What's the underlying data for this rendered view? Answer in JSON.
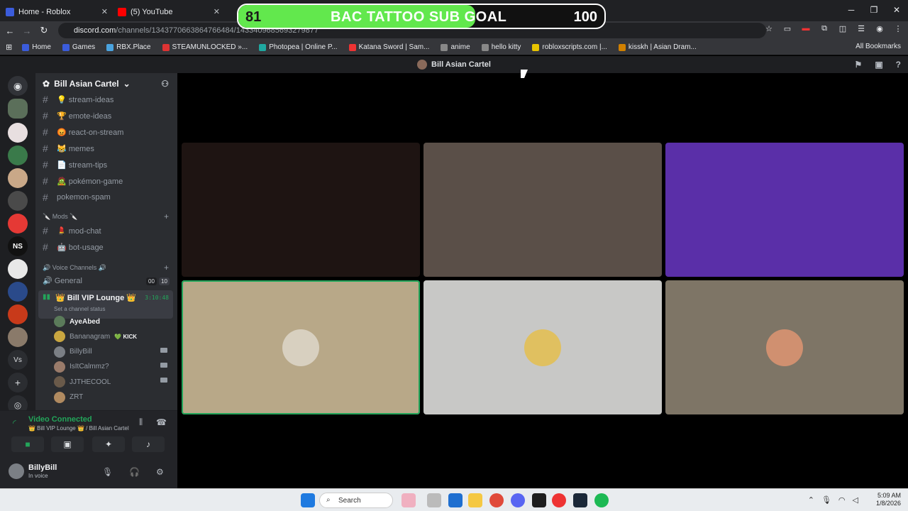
{
  "browser": {
    "tabs": [
      {
        "label": "Home - Roblox",
        "color": "#3b5cdb"
      },
      {
        "label": "(5) YouTube",
        "color": "#ff0000"
      }
    ],
    "url_domain": "discord.com",
    "url_path": "/channels/1343770663864766484/1433409685693279877",
    "bookmarks": [
      {
        "label": "Home",
        "color": "#3b5cdb"
      },
      {
        "label": "Games",
        "color": "#3b5cdb"
      },
      {
        "label": "RBX.Place",
        "color": "#4aa3df"
      },
      {
        "label": "STEAMUNLOCKED »...",
        "color": "#d33"
      },
      {
        "label": "Photopea | Online P...",
        "color": "#1fa8a0"
      },
      {
        "label": "Katana Sword | Sam...",
        "color": "#e33"
      },
      {
        "label": "anime",
        "color": "#888888"
      },
      {
        "label": "hello kitty",
        "color": "#888888"
      },
      {
        "label": "robloxscripts.com |...",
        "color": "#e8c400"
      },
      {
        "label": "kisskh | Asian Dram...",
        "color": "#d08000"
      }
    ],
    "all_bookmarks": "All Bookmarks"
  },
  "goal": {
    "current": "81",
    "title": "BAC TATTOO SUB GOAL",
    "target": "100",
    "progress": 0.81
  },
  "discord": {
    "window_title": "Bill Asian Cartel",
    "server_name": "Bill Asian Cartel",
    "text_channels": [
      {
        "name": "💡 stream-ideas"
      },
      {
        "name": "🏆 emote-ideas"
      },
      {
        "name": "😡 react-on-stream"
      },
      {
        "name": "😹 memes"
      },
      {
        "name": "📄 stream-tips"
      },
      {
        "name": "🧟 pokémon-game"
      },
      {
        "name": "pokemon-spam"
      }
    ],
    "mods_category": "🔪 Mods 🔪",
    "mod_channels": [
      {
        "name": "💄 mod-chat"
      },
      {
        "name": "🤖 bot-usage"
      }
    ],
    "voice_category": "🔊 Voice Channels 🔊",
    "voice_general": "🔊 General",
    "general_counts": [
      "00",
      "10"
    ],
    "vip_lounge": "👑 Bill VIP Lounge 👑",
    "vip_timer": "3:10:48",
    "vip_status": "Set a channel status",
    "members": [
      {
        "name": "AyeAbed",
        "color": "#5b7b5a",
        "bold": true,
        "cam": false,
        "tag": ""
      },
      {
        "name": "Bananagram",
        "color": "#c9a640",
        "bold": false,
        "cam": false,
        "tag": "💚 KICK"
      },
      {
        "name": "BillyBill",
        "color": "#7b7f85",
        "bold": false,
        "cam": true,
        "tag": ""
      },
      {
        "name": "IsItCalmmz?",
        "color": "#9a7b6a",
        "bold": false,
        "cam": true,
        "tag": ""
      },
      {
        "name": "JJTHECOOL",
        "color": "#6a5a4a",
        "bold": false,
        "cam": true,
        "tag": ""
      },
      {
        "name": "ZRT",
        "color": "#b08a60",
        "bold": false,
        "cam": false,
        "tag": ""
      }
    ],
    "voice_panel": {
      "status": "Video Connected",
      "location": "👑 Bill VIP Lounge 👑 / Bill Asian Cartel"
    },
    "user": {
      "name": "BillyBill",
      "status": "In voice"
    }
  },
  "video_tiles": [
    {
      "bg": "#1e1412",
      "avatar": "",
      "speaking": false
    },
    {
      "bg": "#5a4f48",
      "avatar": "",
      "speaking": false
    },
    {
      "bg": "#5a2fa8",
      "avatar": "",
      "speaking": false
    },
    {
      "bg": "#b8a888",
      "avatar": "#d8d0c0",
      "speaking": true
    },
    {
      "bg": "#c8c8c6",
      "avatar": "#e0c060",
      "speaking": false
    },
    {
      "bg": "#7e7566",
      "avatar": "#d09070",
      "speaking": false
    }
  ],
  "taskbar": {
    "search": "Search",
    "time": "5:09 AM",
    "date": "1/8/2026"
  }
}
